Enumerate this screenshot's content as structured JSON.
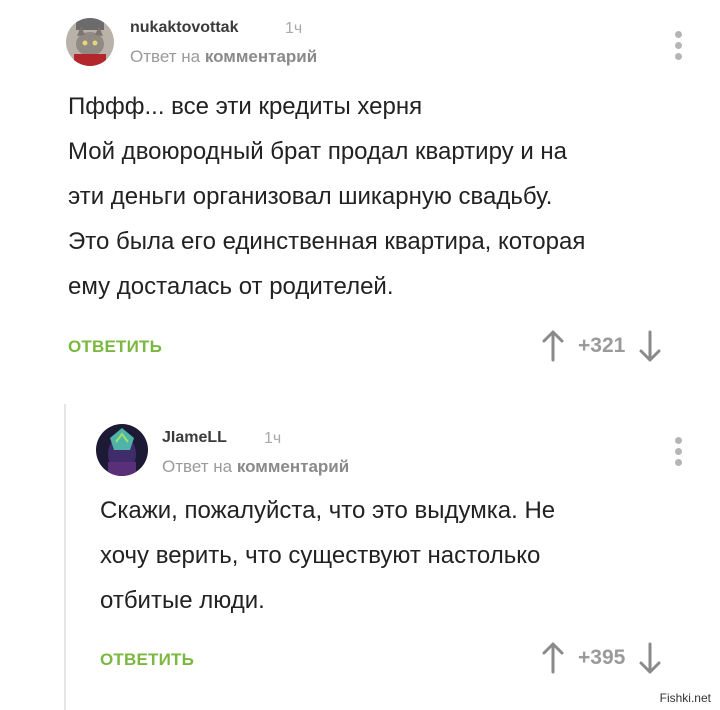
{
  "comments": [
    {
      "username": "nukaktovottak",
      "time": "1ч",
      "reply_prefix": "Ответ на",
      "reply_target": "комментарий",
      "lines": [
        "Пффф... все эти кредиты херня",
        "Мой двоюродный брат продал квартиру и на",
        "эти деньги организовал шикарную свадьбу.",
        "Это была его единственная квартира, которая",
        "ему досталась от родителей."
      ],
      "reply_label": "ОТВЕТИТЬ",
      "score": "+321",
      "avatar_icon": "cat-avatar"
    },
    {
      "username": "JIameLL",
      "time": "1ч",
      "reply_prefix": "Ответ на",
      "reply_target": "комментарий",
      "lines": [
        "Скажи, пожалуйста, что это выдумка. Не",
        "хочу верить, что существуют настолько",
        "отбитые люди."
      ],
      "reply_label": "ОТВЕТИТЬ",
      "score": "+395",
      "avatar_icon": "character-avatar"
    }
  ],
  "watermark": "Fishki.net",
  "colors": {
    "accent_green": "#7bb842",
    "muted": "#9a9a9a"
  }
}
